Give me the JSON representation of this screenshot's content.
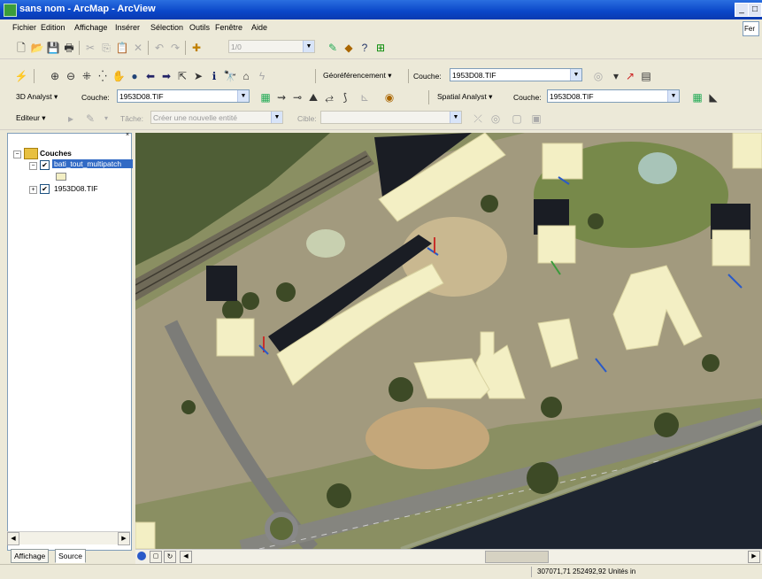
{
  "window": {
    "title": "sans nom - ArcMap - ArcView"
  },
  "menu": {
    "items": [
      "Fichier",
      "Edition",
      "Affichage",
      "Insérer",
      "Sélection",
      "Outils",
      "Fenêtre",
      "Aide"
    ],
    "right_field": "Fer"
  },
  "toolbar1": {
    "scale_value": "1/0"
  },
  "toolbar2": {
    "georef_label": "Géoréférencement",
    "couche_label": "Couche:",
    "couche_value": "1953D08.TIF"
  },
  "toolbar3": {
    "analyst_3d_label": "3D Analyst",
    "couche_label": "Couche:",
    "couche_value": "1953D08.TIF",
    "spatial_label": "Spatial Analyst",
    "couche2_label": "Couche:",
    "couche2_value": "1953D08.TIF"
  },
  "toolbar4": {
    "editor_label": "Editeur",
    "tache_label": "Tâche:",
    "tache_value": "Créer une nouvelle entité",
    "cible_label": "Cible:"
  },
  "toc": {
    "root_label": "Couches",
    "layers": [
      {
        "label": "bati_tout_multipatch",
        "checked": true,
        "selected": true
      },
      {
        "label": "1953D08.TIF",
        "checked": true,
        "selected": false
      }
    ],
    "tabs": [
      "Affichage",
      "Source"
    ]
  },
  "status": {
    "coords": "307071,71  252492,92 Unités in"
  },
  "colors": {
    "title_bar": "#0a46c8",
    "building_fill": "#f3efc4",
    "water": "#1d2430",
    "selection": "#316ac5"
  }
}
